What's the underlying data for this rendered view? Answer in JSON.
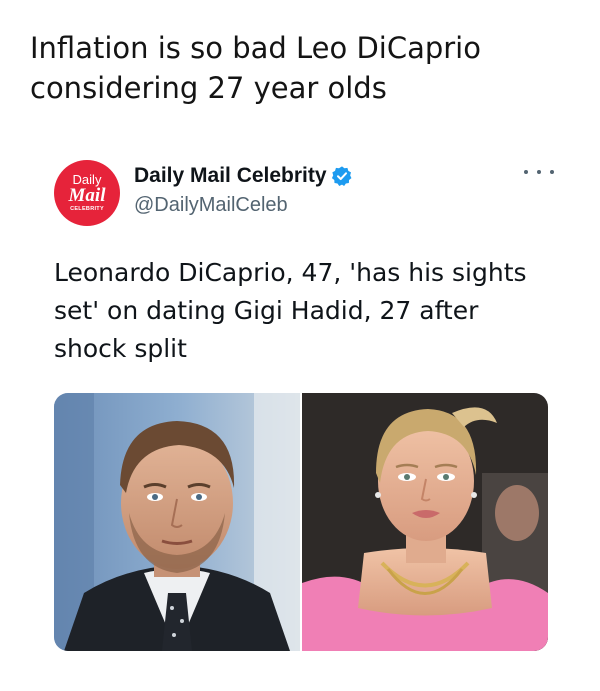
{
  "caption": {
    "line1": "Inflation is so bad Leo DiCaprio",
    "line2": "considering 27 year olds"
  },
  "tweet": {
    "avatar": {
      "line1": "Daily",
      "line2": "Mail",
      "line3": "CELEBRITY",
      "color": "#e6233a"
    },
    "account_name": "Daily Mail Celebrity",
    "handle": "@DailyMailCeleb",
    "verified_icon": "verified-badge-icon",
    "more_icon": "more-options-icon",
    "text_lines": [
      "Leonardo DiCaprio, 47, 'has his sights",
      "set' on dating Gigi Hadid, 27 after",
      "shock split"
    ],
    "media": [
      {
        "name": "photo-leonardo-dicaprio"
      },
      {
        "name": "photo-gigi-hadid"
      }
    ]
  },
  "colors": {
    "verified": "#1d9bf0",
    "handle": "#536471",
    "text": "#0f1419"
  }
}
